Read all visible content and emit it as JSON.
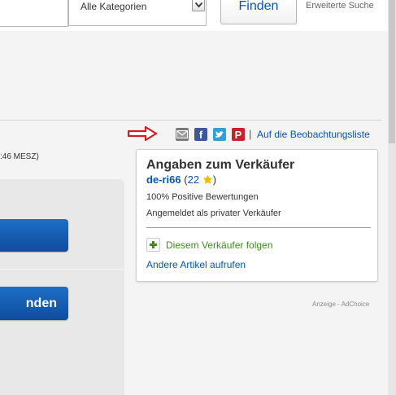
{
  "header": {
    "category_select": "Alle Kategorien",
    "find_button": "Finden",
    "advanced_search": "Erweiterte Suche"
  },
  "share": {
    "icons": [
      "arrow-icon",
      "mail-icon",
      "facebook-icon",
      "twitter-icon",
      "pinterest-icon"
    ],
    "facebook_glyph": "f",
    "pinterest_glyph": "P",
    "separator": "|",
    "watchlist_link": "Auf die Beobachtungsliste"
  },
  "listing": {
    "end_time_fragment": ":46 MESZ)",
    "buy_button_2_fragment": "nden"
  },
  "seller": {
    "title": "Angaben zum Verkäufer",
    "name": "de-ri66",
    "open_paren": " (",
    "feedback_count": "22",
    "close_paren": ")",
    "positive": "100% Positive Bewertungen",
    "account_type": "Angemeldet als privater Verkäufer",
    "follow_label": "Diesem Verkäufer folgen",
    "other_items_label": "Andere Artikel aufrufen"
  },
  "ad": {
    "label": "Anzeige - AdChoice"
  },
  "colors": {
    "link": "#0654ba",
    "follow_green": "#3c8f17",
    "buy_blue": "#0f4c9d",
    "arrow_red": "#d71920",
    "star": "#f5b800"
  }
}
